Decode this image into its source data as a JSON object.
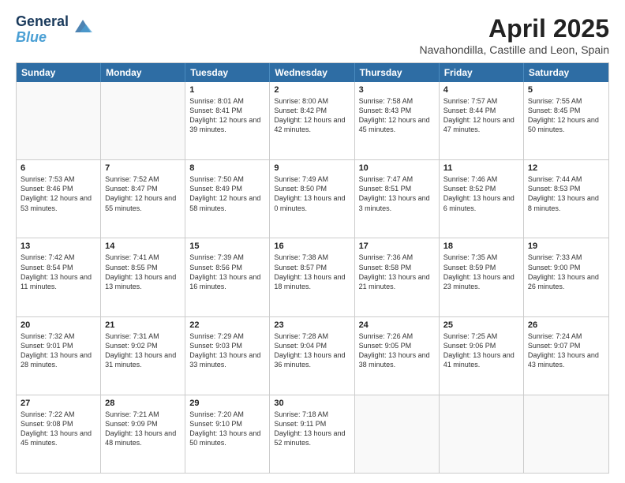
{
  "header": {
    "logo_line1": "General",
    "logo_line2": "Blue",
    "month_year": "April 2025",
    "location": "Navahondilla, Castille and Leon, Spain"
  },
  "days": [
    "Sunday",
    "Monday",
    "Tuesday",
    "Wednesday",
    "Thursday",
    "Friday",
    "Saturday"
  ],
  "weeks": [
    [
      {
        "day": "",
        "text": ""
      },
      {
        "day": "",
        "text": ""
      },
      {
        "day": "1",
        "text": "Sunrise: 8:01 AM\nSunset: 8:41 PM\nDaylight: 12 hours and 39 minutes."
      },
      {
        "day": "2",
        "text": "Sunrise: 8:00 AM\nSunset: 8:42 PM\nDaylight: 12 hours and 42 minutes."
      },
      {
        "day": "3",
        "text": "Sunrise: 7:58 AM\nSunset: 8:43 PM\nDaylight: 12 hours and 45 minutes."
      },
      {
        "day": "4",
        "text": "Sunrise: 7:57 AM\nSunset: 8:44 PM\nDaylight: 12 hours and 47 minutes."
      },
      {
        "day": "5",
        "text": "Sunrise: 7:55 AM\nSunset: 8:45 PM\nDaylight: 12 hours and 50 minutes."
      }
    ],
    [
      {
        "day": "6",
        "text": "Sunrise: 7:53 AM\nSunset: 8:46 PM\nDaylight: 12 hours and 53 minutes."
      },
      {
        "day": "7",
        "text": "Sunrise: 7:52 AM\nSunset: 8:47 PM\nDaylight: 12 hours and 55 minutes."
      },
      {
        "day": "8",
        "text": "Sunrise: 7:50 AM\nSunset: 8:49 PM\nDaylight: 12 hours and 58 minutes."
      },
      {
        "day": "9",
        "text": "Sunrise: 7:49 AM\nSunset: 8:50 PM\nDaylight: 13 hours and 0 minutes."
      },
      {
        "day": "10",
        "text": "Sunrise: 7:47 AM\nSunset: 8:51 PM\nDaylight: 13 hours and 3 minutes."
      },
      {
        "day": "11",
        "text": "Sunrise: 7:46 AM\nSunset: 8:52 PM\nDaylight: 13 hours and 6 minutes."
      },
      {
        "day": "12",
        "text": "Sunrise: 7:44 AM\nSunset: 8:53 PM\nDaylight: 13 hours and 8 minutes."
      }
    ],
    [
      {
        "day": "13",
        "text": "Sunrise: 7:42 AM\nSunset: 8:54 PM\nDaylight: 13 hours and 11 minutes."
      },
      {
        "day": "14",
        "text": "Sunrise: 7:41 AM\nSunset: 8:55 PM\nDaylight: 13 hours and 13 minutes."
      },
      {
        "day": "15",
        "text": "Sunrise: 7:39 AM\nSunset: 8:56 PM\nDaylight: 13 hours and 16 minutes."
      },
      {
        "day": "16",
        "text": "Sunrise: 7:38 AM\nSunset: 8:57 PM\nDaylight: 13 hours and 18 minutes."
      },
      {
        "day": "17",
        "text": "Sunrise: 7:36 AM\nSunset: 8:58 PM\nDaylight: 13 hours and 21 minutes."
      },
      {
        "day": "18",
        "text": "Sunrise: 7:35 AM\nSunset: 8:59 PM\nDaylight: 13 hours and 23 minutes."
      },
      {
        "day": "19",
        "text": "Sunrise: 7:33 AM\nSunset: 9:00 PM\nDaylight: 13 hours and 26 minutes."
      }
    ],
    [
      {
        "day": "20",
        "text": "Sunrise: 7:32 AM\nSunset: 9:01 PM\nDaylight: 13 hours and 28 minutes."
      },
      {
        "day": "21",
        "text": "Sunrise: 7:31 AM\nSunset: 9:02 PM\nDaylight: 13 hours and 31 minutes."
      },
      {
        "day": "22",
        "text": "Sunrise: 7:29 AM\nSunset: 9:03 PM\nDaylight: 13 hours and 33 minutes."
      },
      {
        "day": "23",
        "text": "Sunrise: 7:28 AM\nSunset: 9:04 PM\nDaylight: 13 hours and 36 minutes."
      },
      {
        "day": "24",
        "text": "Sunrise: 7:26 AM\nSunset: 9:05 PM\nDaylight: 13 hours and 38 minutes."
      },
      {
        "day": "25",
        "text": "Sunrise: 7:25 AM\nSunset: 9:06 PM\nDaylight: 13 hours and 41 minutes."
      },
      {
        "day": "26",
        "text": "Sunrise: 7:24 AM\nSunset: 9:07 PM\nDaylight: 13 hours and 43 minutes."
      }
    ],
    [
      {
        "day": "27",
        "text": "Sunrise: 7:22 AM\nSunset: 9:08 PM\nDaylight: 13 hours and 45 minutes."
      },
      {
        "day": "28",
        "text": "Sunrise: 7:21 AM\nSunset: 9:09 PM\nDaylight: 13 hours and 48 minutes."
      },
      {
        "day": "29",
        "text": "Sunrise: 7:20 AM\nSunset: 9:10 PM\nDaylight: 13 hours and 50 minutes."
      },
      {
        "day": "30",
        "text": "Sunrise: 7:18 AM\nSunset: 9:11 PM\nDaylight: 13 hours and 52 minutes."
      },
      {
        "day": "",
        "text": ""
      },
      {
        "day": "",
        "text": ""
      },
      {
        "day": "",
        "text": ""
      }
    ]
  ]
}
